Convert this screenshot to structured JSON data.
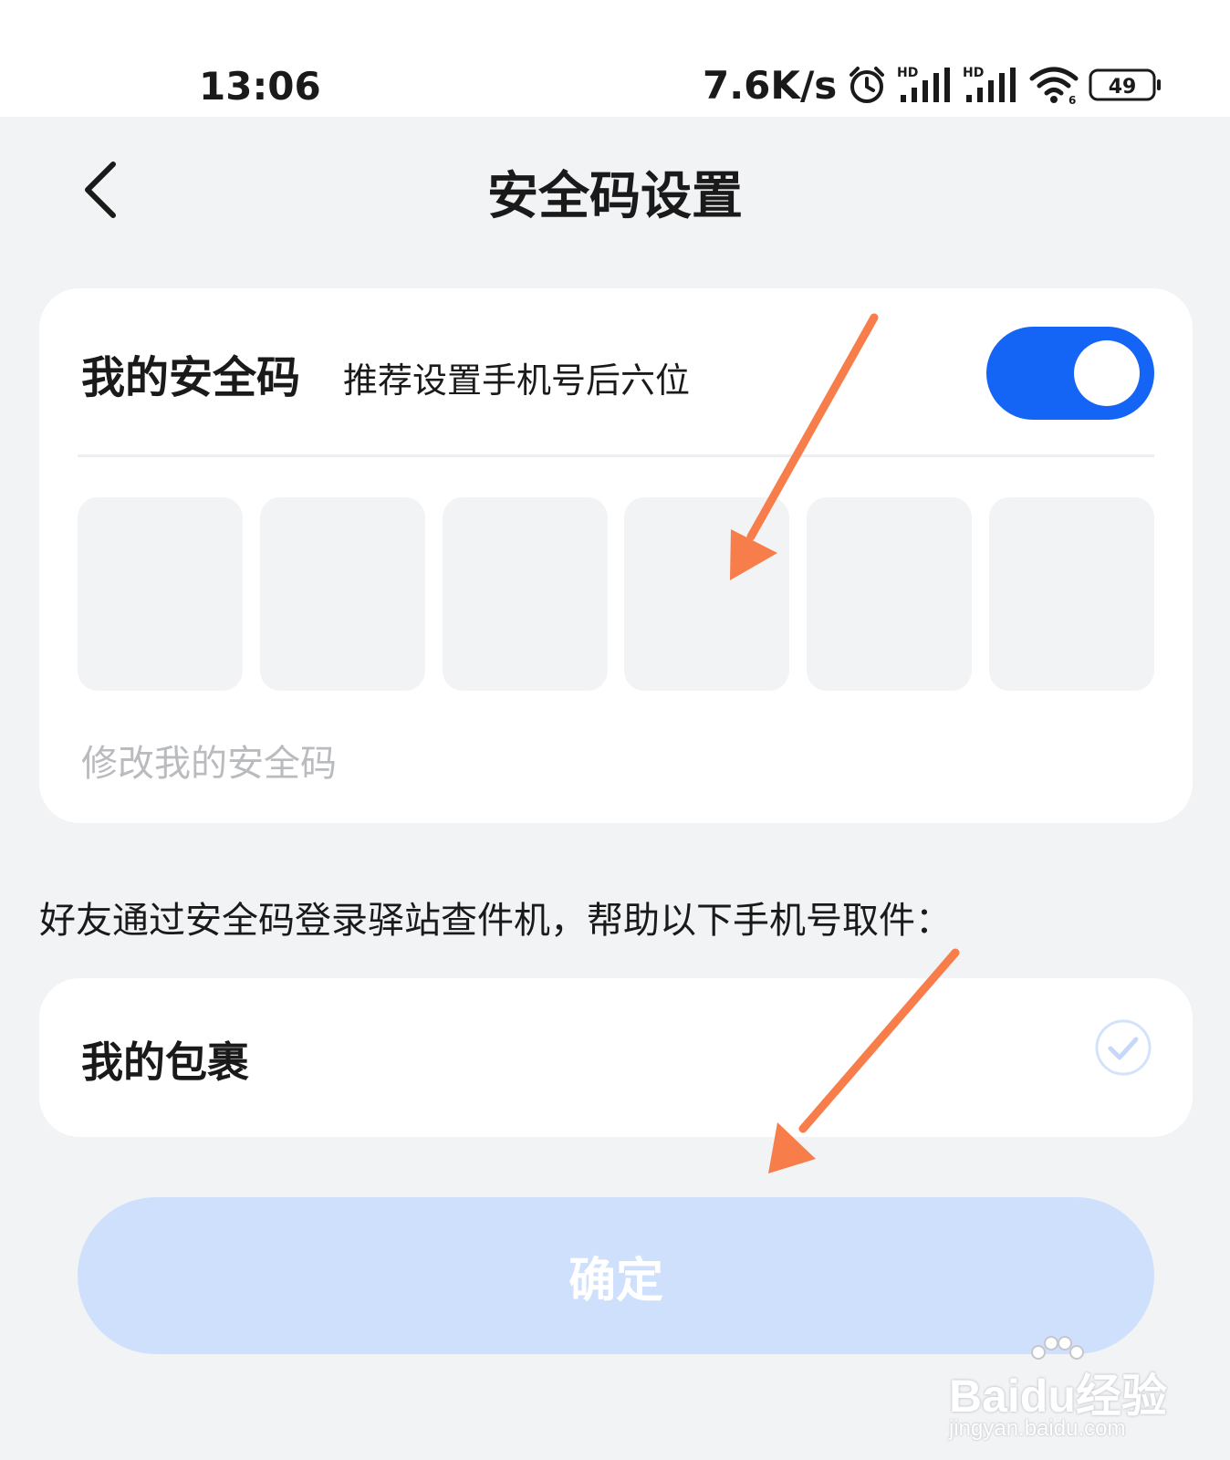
{
  "status_bar": {
    "time": "13:06",
    "net_speed": "7.6K/s",
    "battery_level": "49",
    "icons": [
      "alarm-icon",
      "hd-signal-icon",
      "hd-signal-icon",
      "wifi-icon",
      "battery-icon"
    ]
  },
  "header": {
    "title": "安全码设置",
    "back_icon": "chevron-left-icon"
  },
  "security_code": {
    "title": "我的安全码",
    "hint": "推荐设置手机号后六位",
    "enabled": true,
    "box_count": 6,
    "modify_label": "修改我的安全码"
  },
  "description": "好友通过安全码登录驿站查件机，帮助以下手机号取件：",
  "parcel": {
    "label": "我的包裹",
    "checked": true
  },
  "confirm_label": "确定",
  "watermark": {
    "brand": "Baidu经验",
    "url": "jingyan.baidu.com"
  },
  "colors": {
    "accent": "#1464f5",
    "confirm_bg": "#cfe0fc",
    "annotation_arrow": "#f77e4a",
    "background": "#f2f3f5"
  }
}
